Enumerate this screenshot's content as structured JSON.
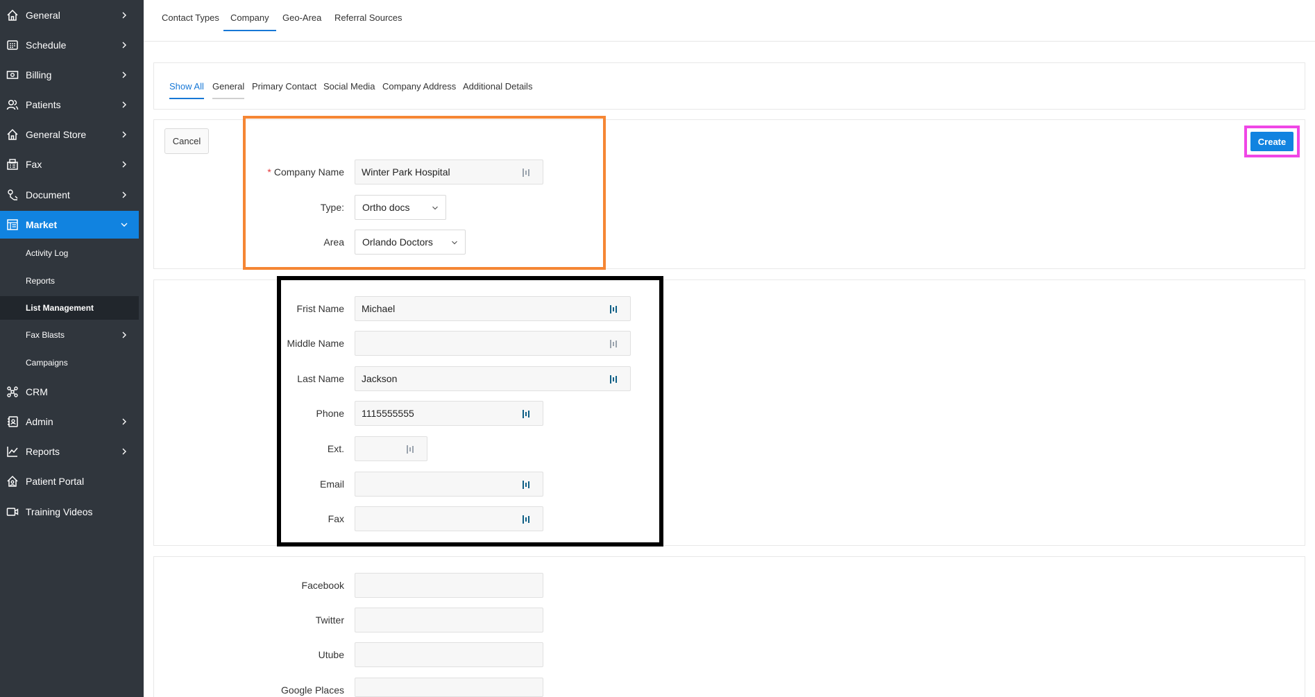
{
  "sidebar": {
    "items": [
      {
        "label": "General",
        "icon": "home-icon",
        "chevron": true
      },
      {
        "label": "Schedule",
        "icon": "calendar-icon",
        "chevron": true
      },
      {
        "label": "Billing",
        "icon": "billing-icon",
        "chevron": true
      },
      {
        "label": "Patients",
        "icon": "users-icon",
        "chevron": true
      },
      {
        "label": "General Store",
        "icon": "store-icon",
        "chevron": true
      },
      {
        "label": "Fax",
        "icon": "fax-icon",
        "chevron": true
      },
      {
        "label": "Document",
        "icon": "document-icon",
        "chevron": true
      },
      {
        "label": "Market",
        "icon": "market-icon",
        "chevron": true,
        "active": true
      },
      {
        "label": "CRM",
        "icon": "crm-icon",
        "chevron": false
      },
      {
        "label": "Admin",
        "icon": "admin-icon",
        "chevron": true
      },
      {
        "label": "Reports",
        "icon": "chart-icon",
        "chevron": true
      },
      {
        "label": "Patient Portal",
        "icon": "portal-icon",
        "chevron": false
      },
      {
        "label": "Training Videos",
        "icon": "video-icon",
        "chevron": false
      }
    ],
    "market_sub": [
      {
        "label": "Activity Log"
      },
      {
        "label": "Reports"
      },
      {
        "label": "List Management",
        "current": true
      },
      {
        "label": "Fax Blasts",
        "chevron": true
      },
      {
        "label": "Campaigns"
      }
    ]
  },
  "top_tabs": [
    "Contact Types",
    "Company",
    "Geo-Area",
    "Referral Sources"
  ],
  "active_top_tab": "Company",
  "section_tabs": [
    "Show All",
    "General",
    "Primary Contact",
    "Social Media",
    "Company Address",
    "Additional Details"
  ],
  "active_section_tab": "Show All",
  "actions": {
    "cancel": "Cancel",
    "create": "Create"
  },
  "general": {
    "company_name_label": "Company Name",
    "company_name_required": "*",
    "company_name_value": "Winter Park Hospital",
    "type_label": "Type:",
    "type_value": "Ortho docs",
    "area_label": "Area",
    "area_value": "Orlando Doctors"
  },
  "primary_contact": {
    "first_name_label": "Frist Name",
    "first_name_value": "Michael",
    "middle_name_label": "Middle Name",
    "middle_name_value": "",
    "last_name_label": "Last Name",
    "last_name_value": "Jackson",
    "phone_label": "Phone",
    "phone_value": "1115555555",
    "ext_label": "Ext.",
    "ext_value": "",
    "email_label": "Email",
    "email_value": "",
    "fax_label": "Fax",
    "fax_value": ""
  },
  "social_media": {
    "facebook_label": "Facebook",
    "twitter_label": "Twitter",
    "utube_label": "Utube",
    "google_places_label": "Google Places"
  },
  "colors": {
    "sidebar_bg": "#30363d",
    "accent": "#1183e0",
    "orange_highlight": "#f58634",
    "magenta_highlight": "#f046e6",
    "black_highlight": "#000000"
  }
}
